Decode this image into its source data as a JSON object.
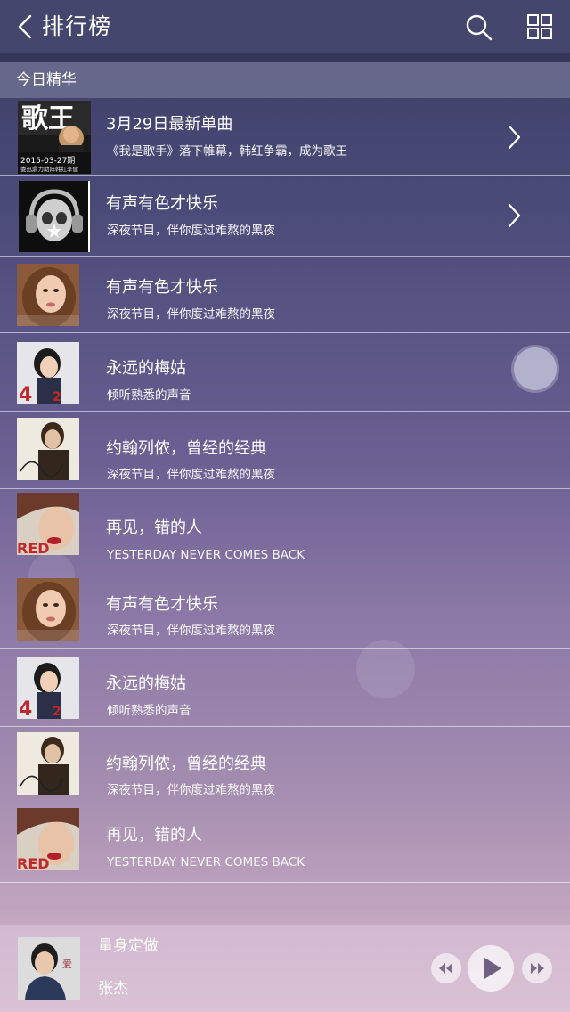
{
  "header": {
    "title": "排行榜",
    "back_icon": "chevron-left-icon",
    "search_icon": "search-icon",
    "grid_icon": "grid-icon"
  },
  "section": {
    "title": "今日精华"
  },
  "list": [
    {
      "title": "3月29日最新单曲",
      "subtitle": "《我是歌手》落下帷幕，韩红争霸，成为歌王",
      "cover_text": [
        "歌王",
        "2015-03-27期",
        "娄迅鼎力助阵韩红李健"
      ],
      "has_arrow": true
    },
    {
      "title": "有声有色才快乐",
      "subtitle": "深夜节目，伴你度过难熬的黑夜",
      "has_arrow": true
    },
    {
      "title": "有声有色才快乐",
      "subtitle": "深夜节目，伴你度过难熬的黑夜",
      "has_arrow": false
    },
    {
      "title": "永远的梅姑",
      "subtitle": "倾听熟悉的声音",
      "has_arrow": false
    },
    {
      "title": "约翰列侬，曾经的经典",
      "subtitle": "深夜节目，伴你度过难熬的黑夜",
      "has_arrow": false
    },
    {
      "title": "再见，错的人",
      "subtitle": "YESTERDAY NEVER COMES BACK",
      "has_arrow": false,
      "cover_text": [
        "RED"
      ]
    },
    {
      "title": "有声有色才快乐",
      "subtitle": "深夜节目，伴你度过难熬的黑夜",
      "has_arrow": false
    },
    {
      "title": "永远的梅姑",
      "subtitle": "倾听熟悉的声音",
      "has_arrow": false
    },
    {
      "title": "约翰列侬，曾经的经典",
      "subtitle": "深夜节目，伴你度过难熬的黑夜",
      "has_arrow": false
    },
    {
      "title": "再见，错的人",
      "subtitle": "YESTERDAY NEVER COMES BACK",
      "has_arrow": false,
      "cover_text": [
        "RED"
      ]
    }
  ],
  "player": {
    "title": "量身定做",
    "artist": "张杰",
    "cover_text": "爱",
    "prev_icon": "rewind-icon",
    "play_icon": "play-icon",
    "next_icon": "fast-forward-icon"
  },
  "colors": {
    "header_bg": "#464870",
    "accent_red": "#c0282a"
  }
}
